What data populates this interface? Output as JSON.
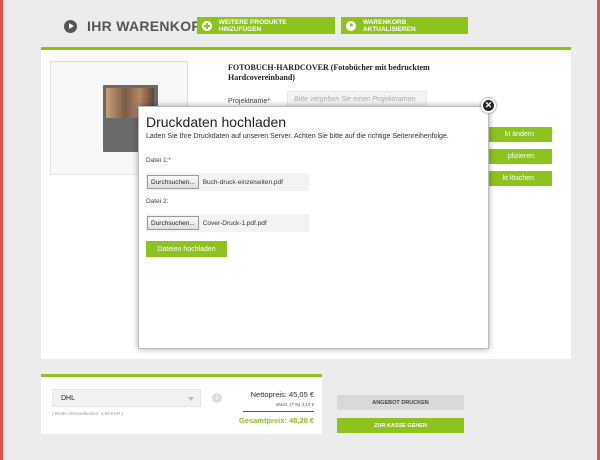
{
  "header": {
    "title": "IHR WARENKORB",
    "add_button": "WEITERE PRODUKTE HINZUFÜGEN",
    "update_button": "WARENKORB AKTUALISIEREN"
  },
  "product": {
    "title": "FOTOBUCH-HARDCOVER (Fotobücher mit bedrucktem Hardcovereinband)",
    "project_label": "Projektname*",
    "project_placeholder": "Bitte vergeben Sie einen Projektnamen",
    "actions": [
      "kt ändern",
      "plizieren",
      "kt löschen"
    ]
  },
  "modal": {
    "title": "Druckdaten hochladen",
    "description": "Laden Sie Ihre Druckdaten auf unseren Server. Achten Sie bitte auf die richtige Seitenreihenfolge.",
    "files": [
      {
        "label": "Datei 1:*",
        "browse": "Durchsuchen...",
        "filename": "Buch-druck-einzelseiten.pdf"
      },
      {
        "label": "Datei 2:",
        "browse": "Durchsuchen...",
        "filename": "Cover-Druck-1.pdf.pdf"
      }
    ],
    "upload_button": "Dateien hochladen",
    "close_glyph": "✕"
  },
  "summary": {
    "shipping": "DHL",
    "shipping_note": "( Brutto-Versandkosten: 4,90 EUR )",
    "info_glyph": "i",
    "netto": "Nettopreis: 45,05 €",
    "mwst": "MwSt. (7 %) 3,15 €",
    "gesamt": "Gesamtpreis: 48,20 €"
  },
  "footer": {
    "offer_button": "ANGEBOT DRUCKEN",
    "checkout_button": "ZUR KASSE GEHEN"
  }
}
